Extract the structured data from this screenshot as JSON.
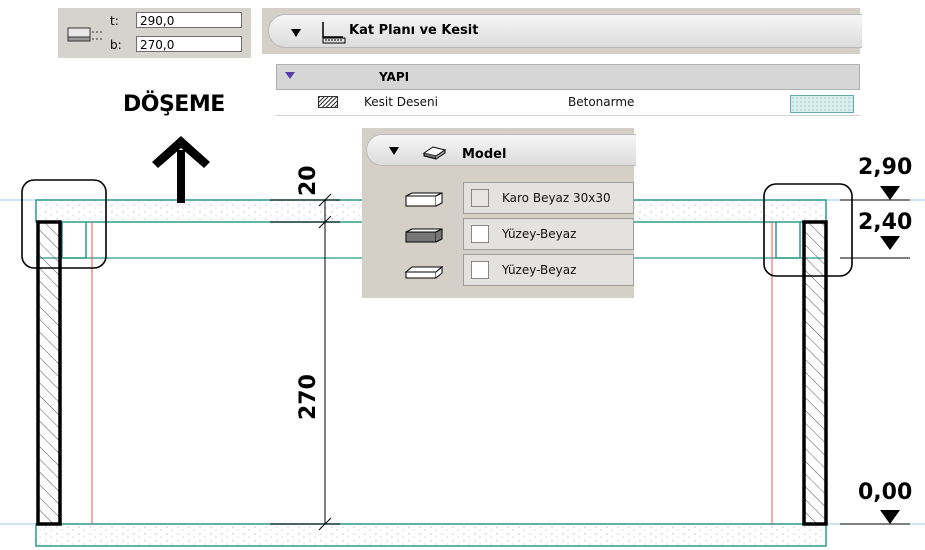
{
  "height_fields": {
    "top_label": "t:",
    "top_value": "290,0",
    "bottom_label": "b:",
    "bottom_value": "270,0"
  },
  "floor_panel": {
    "title": "Kat Planı ve Kesit",
    "section_label": "YAPI",
    "row_label": "Kesit Deseni",
    "row_value": "Betonarme",
    "swatch_color": "#d7f0ee"
  },
  "model_panel": {
    "title": "Model",
    "items": [
      {
        "icon": "slab-top-icon",
        "label": "Karo Beyaz 30x30"
      },
      {
        "icon": "slab-side-icon",
        "label": "Yüzey-Beyaz"
      },
      {
        "icon": "slab-bottom-icon",
        "label": "Yüzey-Beyaz"
      }
    ]
  },
  "annotation": {
    "label": "DÖŞEME"
  },
  "dimensions": {
    "slab_thickness": "20",
    "wall_height": "270"
  },
  "elevations": {
    "top": "2,90",
    "slab_bottom": "2,40",
    "floor": "0,00"
  },
  "colors": {
    "slab_line": "#2a9a8e",
    "red_line": "#ff5050",
    "wall": "#000000"
  }
}
